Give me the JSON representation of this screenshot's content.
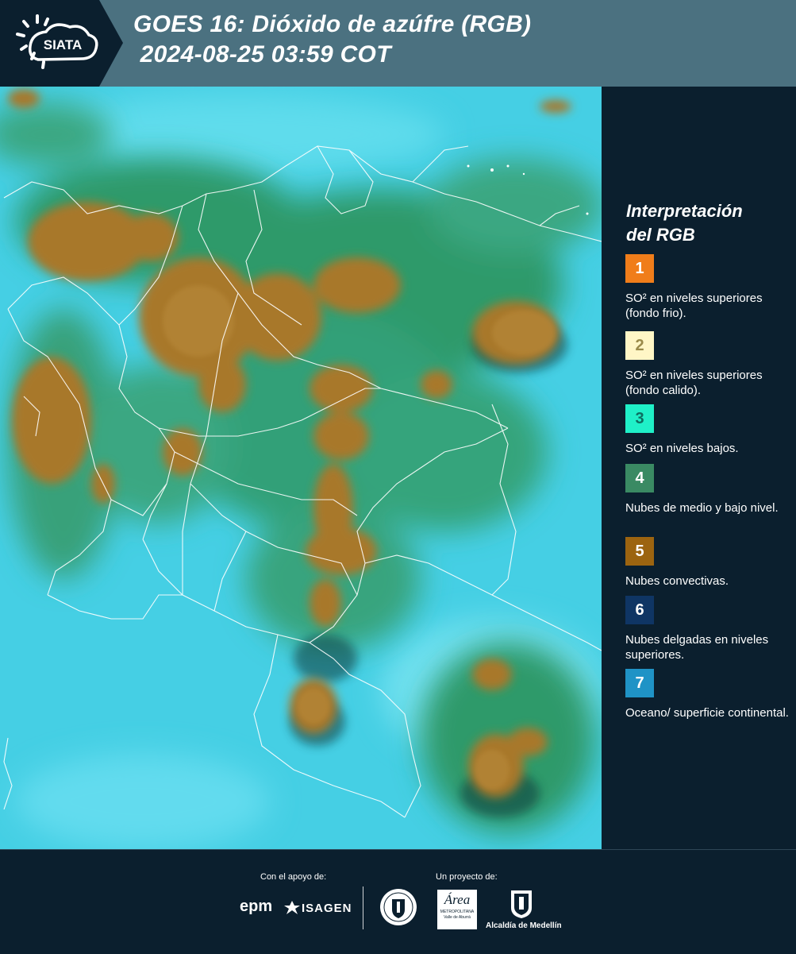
{
  "header": {
    "logo_text": "SIATA",
    "title_line1": "GOES 16: Dióxido de azúfre (RGB)",
    "title_line2": " 2024-08-25 03:59 COT"
  },
  "legend": {
    "title_line1": "Interpretación",
    "title_line2": "del RGB",
    "items": [
      {
        "num": "1",
        "color": "#f07d1a",
        "num_color": "#ffffff",
        "label": "SO² en niveles superiores (fondo frio)."
      },
      {
        "num": "2",
        "color": "#fff6c6",
        "num_color": "#9a8a4a",
        "label": "SO² en niveles superiores (fondo calido)."
      },
      {
        "num": "3",
        "color": "#1ff0c8",
        "num_color": "#0d6e60",
        "label": "SO² en niveles bajos."
      },
      {
        "num": "4",
        "color": "#3a8a63",
        "num_color": "#ffffff",
        "label": "Nubes de medio y bajo nivel."
      },
      {
        "num": "5",
        "color": "#9c6410",
        "num_color": "#ffffff",
        "label": "Nubes convectivas."
      },
      {
        "num": "6",
        "color": "#0f3564",
        "num_color": "#ffffff",
        "label": "Nubes delgadas en niveles superiores."
      },
      {
        "num": "7",
        "color": "#1f93c6",
        "num_color": "#ffffff",
        "label": "Oceano/ superficie continental."
      }
    ]
  },
  "footer": {
    "support_label": "Con el apoyo de:",
    "project_label": "Un proyecto de:",
    "epm": "epm",
    "isagen": "ISAGEN",
    "area_text": "Área",
    "area_sub1": "METROPOLITANA",
    "area_sub2": "Valle de Aburrá",
    "alcaldia": "Alcaldía de Medellín"
  }
}
